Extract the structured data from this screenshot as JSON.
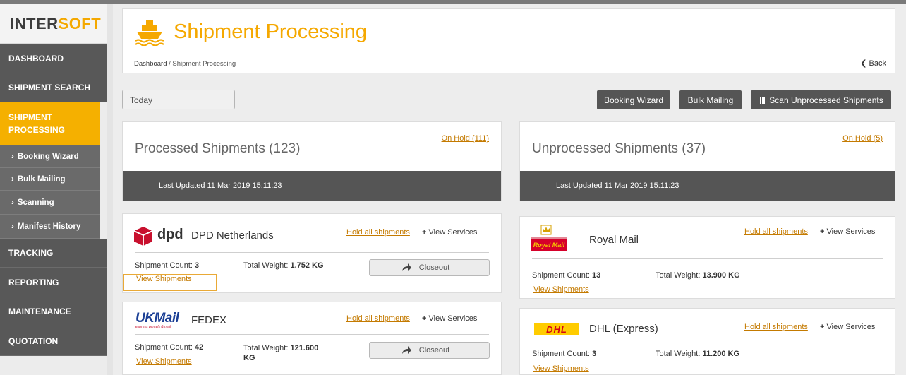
{
  "app": {
    "logo_prefix": "I",
    "logo_middle": "NTER",
    "logo_suffix": "SOFT"
  },
  "sidebar": {
    "items": [
      {
        "label": "DASHBOARD"
      },
      {
        "label": "SHIPMENT SEARCH"
      },
      {
        "label": "SHIPMENT PROCESSING"
      },
      {
        "label": "TRACKING"
      },
      {
        "label": "REPORTING"
      },
      {
        "label": "MAINTENANCE"
      },
      {
        "label": "QUOTATION"
      }
    ],
    "subitems": [
      {
        "label": "Booking Wizard"
      },
      {
        "label": "Bulk Mailing"
      },
      {
        "label": "Scanning"
      },
      {
        "label": "Manifest History"
      }
    ]
  },
  "header": {
    "title": "Shipment Processing",
    "breadcrumb_home": "Dashboard",
    "breadcrumb_sep": "/",
    "breadcrumb_current": "Shipment Processing",
    "back_label": "Back"
  },
  "toolbar": {
    "date_value": "Today",
    "booking_wizard": "Booking Wizard",
    "bulk_mailing": "Bulk Mailing",
    "scan_unprocessed": "Scan Unprocessed Shipments"
  },
  "summary": {
    "processed": {
      "title": "Processed Shipments (123)",
      "on_hold": "On Hold (111)",
      "updated": "Last Updated 11 Mar 2019 15:11:23"
    },
    "unprocessed": {
      "title": "Unprocessed Shipments (37)",
      "on_hold": "On Hold (5)",
      "updated": "Last Updated 11 Mar 2019 15:11:23"
    }
  },
  "carriers": {
    "dpd": {
      "name": "DPD Netherlands",
      "hold": "Hold all shipments",
      "view_services": "View Services",
      "count_label": "Shipment Count:",
      "count": "3",
      "weight_label": "Total Weight:",
      "weight": "1.752 KG",
      "view_shipments": "View Shipments",
      "closeout": "Closeout"
    },
    "fedex": {
      "name": "FEDEX",
      "hold": "Hold all shipments",
      "view_services": "View Services",
      "count_label": "Shipment Count:",
      "count": "42",
      "weight_label": "Total Weight:",
      "weight": "121.600",
      "weight_unit": "KG",
      "view_shipments": "View Shipments",
      "closeout": "Closeout"
    },
    "royal": {
      "name": "Royal Mail",
      "hold": "Hold all shipments",
      "view_services": "View Services",
      "count_label": "Shipment Count:",
      "count": "13",
      "weight_label": "Total Weight:",
      "weight": "13.900 KG",
      "view_shipments": "View Shipments"
    },
    "dhl": {
      "name": "DHL (Express)",
      "hold": "Hold all shipments",
      "view_services": "View Services",
      "count_label": "Shipment Count:",
      "count": "3",
      "weight_label": "Total Weight:",
      "weight": "11.200 KG",
      "view_shipments": "View Shipments"
    }
  },
  "logos": {
    "dpd_text": "dpd",
    "ukmail_text": "UKMail",
    "ukmail_tagline": "express parcels & mail",
    "royalmail_text": "Royal Mail",
    "dhl_text": "DHL"
  },
  "colors": {
    "accent": "#f5b000",
    "sidebar_bg": "#585858",
    "link": "#c47a00",
    "bar_bg": "#555555"
  }
}
